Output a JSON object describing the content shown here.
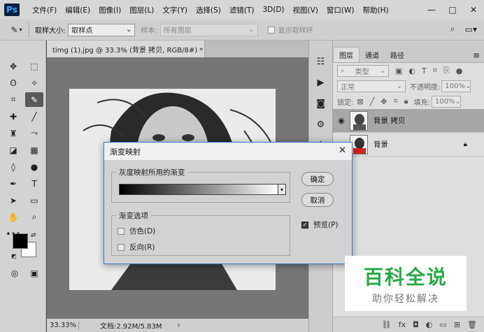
{
  "app": {
    "logo": "Ps",
    "menu": [
      "文件(F)",
      "编辑(E)",
      "图像(I)",
      "图层(L)",
      "文字(Y)",
      "选择(S)",
      "滤镜(T)",
      "3D(D)",
      "视图(V)",
      "窗口(W)",
      "帮助(H)"
    ],
    "window_controls": [
      "—",
      "□",
      "✕"
    ]
  },
  "options": {
    "sample_size_label": "取样大小:",
    "sample_size_value": "取样点",
    "sample_label": "样本:",
    "sample_value": "所有图层",
    "show_ring_label": "显示取样环"
  },
  "document": {
    "tab_title": "timg (1).jpg @ 33.3% (背景 拷贝, RGB/8#) *",
    "tab_close": "×",
    "zoom": "33.33%",
    "doc_info": "文档:2.92M/5.83M",
    "status_arrow": "›"
  },
  "layers_panel": {
    "tabs": [
      "图层",
      "通道",
      "路径"
    ],
    "active_tab": "图层",
    "filter_kind": "类型",
    "blend_mode": "正常",
    "opacity_label": "不透明度:",
    "opacity_value": "100%",
    "lock_label": "锁定:",
    "fill_label": "填充:",
    "fill_value": "100%",
    "layers": [
      {
        "name": "背景 拷贝",
        "visible": true,
        "selected": true,
        "locked": false,
        "thumb_color": "#444444"
      },
      {
        "name": "背景",
        "visible": false,
        "selected": false,
        "locked": true,
        "thumb_color": "#d62020"
      }
    ]
  },
  "dialog": {
    "title": "渐变映射",
    "group_gradient": "灰度映射所用的渐变",
    "group_options": "渐变选项",
    "dither_label": "仿色(D)",
    "dither_checked": false,
    "reverse_label": "反向(R)",
    "reverse_checked": false,
    "ok_label": "确定",
    "cancel_label": "取消",
    "preview_label": "预览(P)",
    "preview_checked": true
  },
  "watermark": {
    "main": "百科全说",
    "sub": "助你轻松解决"
  },
  "colors": {
    "accent": "#3a7bd5",
    "foreground": "#000000",
    "background": "#ffffff",
    "watermark_green": "#2aa84a"
  }
}
